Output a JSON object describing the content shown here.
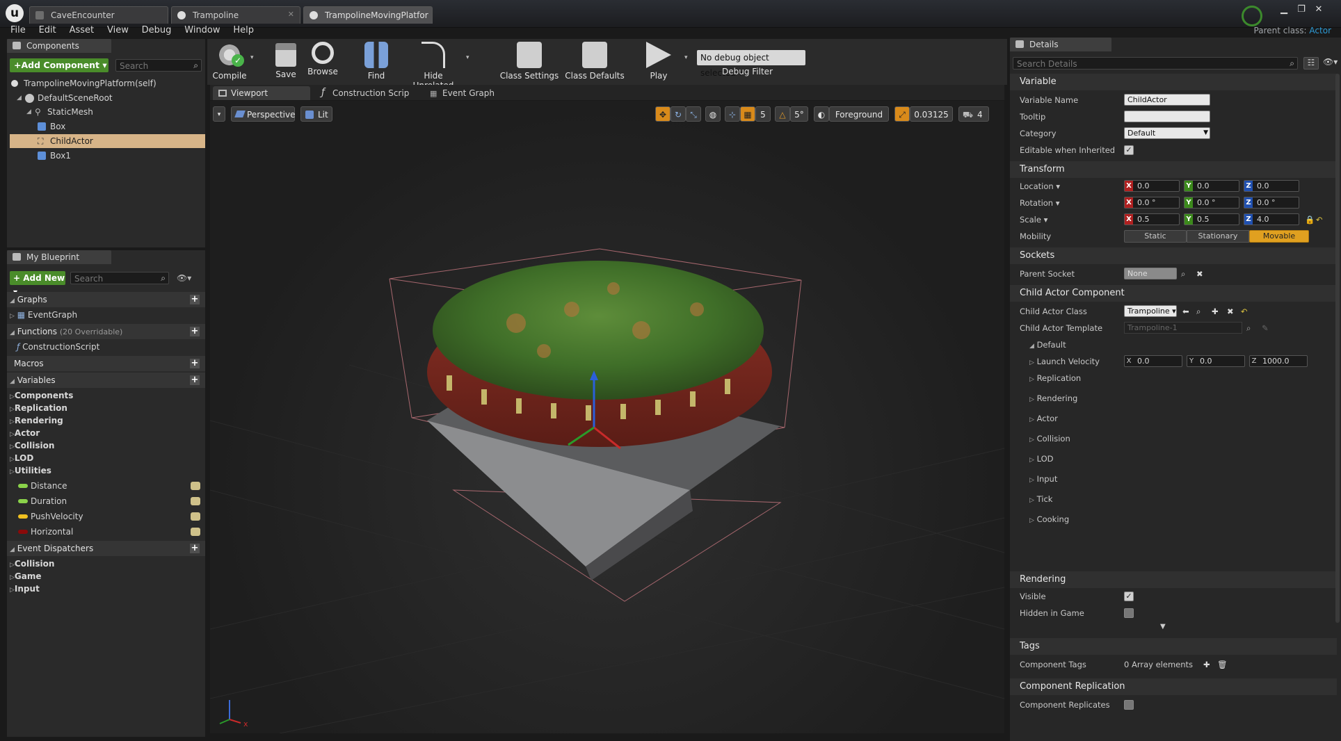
{
  "titlebar": {
    "tabs": [
      {
        "label": "CaveEncounter"
      },
      {
        "label": "Trampoline"
      },
      {
        "label": "TrampolineMovingPlatfor"
      }
    ],
    "parent_class_label": "Parent class:",
    "parent_class_value": "Actor"
  },
  "menubar": {
    "items": [
      "File",
      "Edit",
      "Asset",
      "View",
      "Debug",
      "Window",
      "Help"
    ]
  },
  "components": {
    "tab_label": "Components",
    "add_label": "+Add Component",
    "search_placeholder": "Search",
    "self_label": "TrampolineMovingPlatform(self)",
    "tree": [
      "DefaultSceneRoot",
      "StaticMesh",
      "Box",
      "ChildActor",
      "Box1"
    ]
  },
  "myblueprint": {
    "tab_label": "My Blueprint",
    "add_new_label": "+ Add New",
    "search_placeholder": "Search",
    "graphs_label": "Graphs",
    "event_graph": "EventGraph",
    "functions_label": "Functions",
    "functions_note": "(20 Overridable)",
    "construction_script": "ConstructionScript",
    "macros_label": "Macros",
    "variables_label": "Variables",
    "categories": [
      "Components",
      "Replication",
      "Rendering",
      "Actor",
      "Collision",
      "LOD",
      "Utilities"
    ],
    "variables": [
      {
        "name": "Distance",
        "color": "#8ad24a"
      },
      {
        "name": "Duration",
        "color": "#8ad24a"
      },
      {
        "name": "PushVelocity",
        "color": "#f0c020"
      },
      {
        "name": "Horizontal",
        "color": "#8b0a0a"
      }
    ],
    "event_dispatchers_label": "Event Dispatchers",
    "dispatcher_categories": [
      "Collision",
      "Game",
      "Input"
    ]
  },
  "toolbar": {
    "compile": "Compile",
    "save": "Save",
    "browse": "Browse",
    "find": "Find",
    "hide_unrelated": "Hide Unrelated",
    "class_settings": "Class Settings",
    "class_defaults": "Class Defaults",
    "play": "Play",
    "debug_object": "No debug object selected",
    "debug_filter": "Debug Filter"
  },
  "editor_tabs": [
    "Viewport",
    "Construction Scrip",
    "Event Graph"
  ],
  "viewport": {
    "perspective": "Perspective",
    "lit": "Lit",
    "grid_snap": "5",
    "rot_snap": "5°",
    "foreground": "Foreground",
    "scale_snap": "0.03125",
    "camera_speed": "4"
  },
  "details": {
    "tab_label": "Details",
    "search_placeholder": "Search Details",
    "variable": {
      "header": "Variable",
      "name_label": "Variable Name",
      "name_value": "ChildActor",
      "tooltip_label": "Tooltip",
      "tooltip_value": "",
      "category_label": "Category",
      "category_value": "Default",
      "editable_label": "Editable when Inherited"
    },
    "transform": {
      "header": "Transform",
      "location_label": "Location",
      "location": [
        "0.0",
        "0.0",
        "0.0"
      ],
      "rotation_label": "Rotation",
      "rotation": [
        "0.0 °",
        "0.0 °",
        "0.0 °"
      ],
      "scale_label": "Scale",
      "scale": [
        "0.5",
        "0.5",
        "4.0"
      ],
      "mobility_label": "Mobility",
      "mobility_options": [
        "Static",
        "Stationary",
        "Movable"
      ],
      "axis_labels": [
        "X",
        "Y",
        "Z"
      ]
    },
    "sockets": {
      "header": "Sockets",
      "parent_socket_label": "Parent Socket",
      "parent_socket_value": "None"
    },
    "child_actor": {
      "header": "Child Actor Component",
      "class_label": "Child Actor Class",
      "class_value": "Trampoline",
      "template_label": "Child Actor Template",
      "template_value": "Trampoline-1",
      "default_label": "Default",
      "launch_velocity_label": "Launch Velocity",
      "launch_velocity": [
        "0.0",
        "0.0",
        "1000.0"
      ],
      "subcategories": [
        "Replication",
        "Rendering",
        "Actor",
        "Collision",
        "LOD",
        "Input",
        "Tick",
        "Cooking"
      ]
    },
    "rendering": {
      "header": "Rendering",
      "visible_label": "Visible",
      "hidden_label": "Hidden in Game"
    },
    "tags": {
      "header": "Tags",
      "component_tags_label": "Component Tags",
      "component_tags_value": "0 Array elements"
    },
    "replication": {
      "header": "Component Replication",
      "replicates_label": "Component Replicates"
    }
  }
}
